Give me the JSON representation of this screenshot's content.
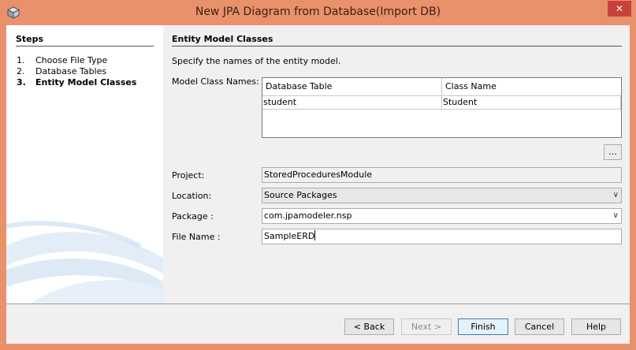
{
  "window": {
    "title": "New JPA Diagram from Database(Import DB)",
    "close_glyph": "✕",
    "accent": "#e9916b"
  },
  "steps": {
    "title": "Steps",
    "items": [
      {
        "num": "1.",
        "label": "Choose File Type"
      },
      {
        "num": "2.",
        "label": "Database Tables"
      },
      {
        "num": "3.",
        "label": "Entity Model Classes"
      }
    ]
  },
  "content": {
    "title": "Entity Model Classes",
    "description": "Specify the names of the entity model.",
    "model_class_label": "Model Class Names:",
    "table": {
      "headers": [
        "Database Table",
        "Class Name"
      ],
      "rows": [
        [
          "student",
          "Student"
        ]
      ]
    },
    "dots_label": "...",
    "project_label": "Project:",
    "project_value": "StoredProceduresModule",
    "location_label": "Location:",
    "location_value": "Source Packages",
    "package_label": "Package :",
    "package_value": "com.jpamodeler.nsp",
    "filename_label": "File Name :",
    "filename_value": "SampleERD"
  },
  "buttons": {
    "back": "< Back",
    "next": "Next >",
    "finish": "Finish",
    "cancel": "Cancel",
    "help": "Help"
  },
  "icons": {
    "app": "cube-icon",
    "chevron": "chevron-down-icon"
  }
}
